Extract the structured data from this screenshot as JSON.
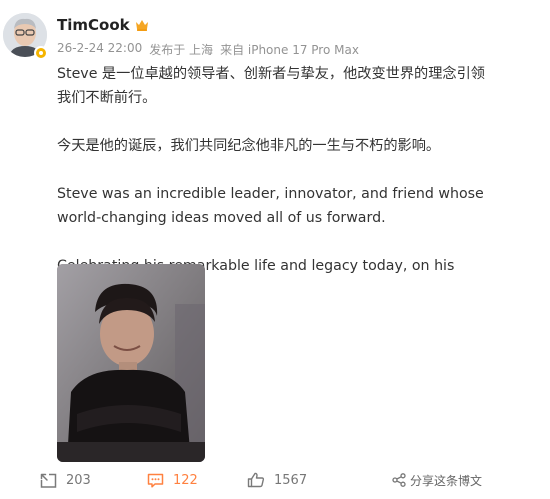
{
  "post": {
    "author": "TimCook",
    "timestamp": "26-2-24 22:00",
    "location": "发布于 上海",
    "device": "来自 iPhone 17 Pro Max",
    "paragraphs": [
      "Steve 是一位卓越的领导者、创新者与挚友，他改变世界的理念引领我们不断前行。",
      "今天是他的诞辰，我们共同纪念他非凡的一生与不朽的影响。",
      "Steve was an incredible leader, innovator, and friend whose world-changing ideas moved all of us forward.",
      "Celebrating his remarkable life and legacy today, on his birthday."
    ],
    "image": "portrait-photo"
  },
  "actions": {
    "repost_count": "203",
    "comment_count": "122",
    "like_count": "1567",
    "share_label": "分享这条博文"
  },
  "colors": {
    "accent": "#ff8140",
    "verified": "#f5b400",
    "meta": "#939393"
  },
  "icons": [
    "crown-icon",
    "verified-badge-icon",
    "repost-icon",
    "comment-icon",
    "like-icon",
    "share-icon"
  ]
}
